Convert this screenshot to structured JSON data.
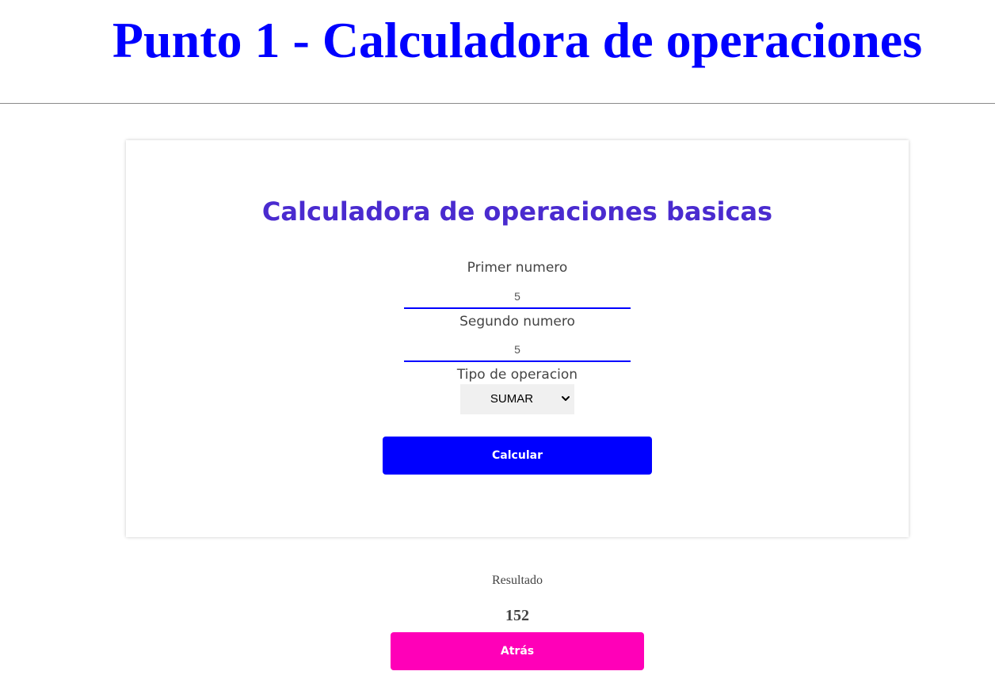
{
  "header": {
    "title": "Punto 1 - Calculadora de operaciones"
  },
  "calculator": {
    "title": "Calculadora de operaciones basicas",
    "first_number_label": "Primer numero",
    "first_number_value": "5",
    "second_number_label": "Segundo numero",
    "second_number_value": "5",
    "operation_label": "Tipo de operacion",
    "operation_selected": "SUMAR",
    "calculate_label": "Calcular"
  },
  "result": {
    "label": "Resultado",
    "value": "152",
    "back_label": "Atrás"
  },
  "colors": {
    "title": "#0000ff",
    "card_title": "#4a2bcf",
    "input_underline": "#0000ff",
    "calculate_button": "#0000ff",
    "back_button": "#ff00b8"
  },
  "icons": {
    "select_arrow": "chevron-down-icon"
  }
}
